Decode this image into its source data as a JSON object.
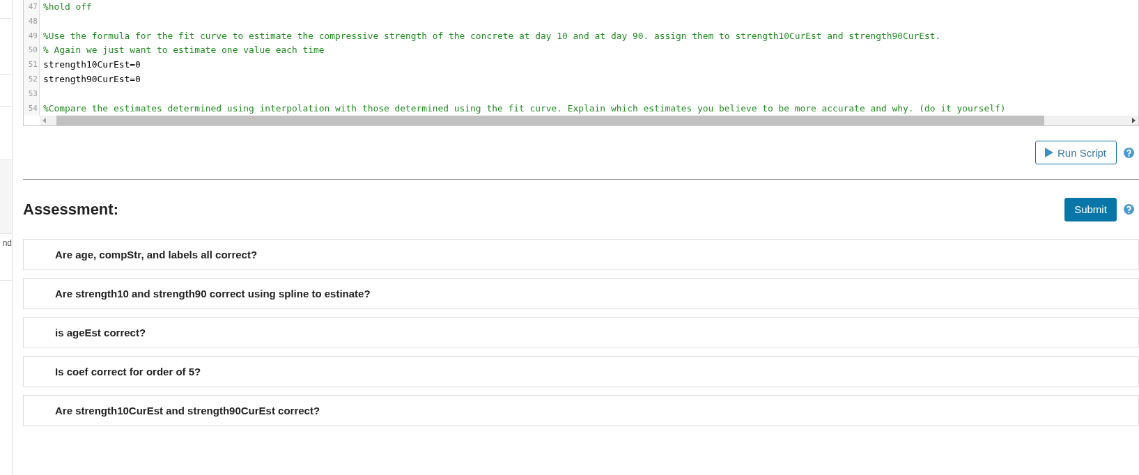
{
  "sidebar": {
    "text": "nd"
  },
  "editor": {
    "lines": [
      {
        "number": "47",
        "kind": "comment",
        "text": "%hold off"
      },
      {
        "number": "48",
        "kind": "blank"
      },
      {
        "number": "49",
        "kind": "comment",
        "text": "%Use the formula for the fit curve to estimate the compressive strength of the concrete at day 10 and at day 90. assign them to strength10CurEst and strength90CurEst."
      },
      {
        "number": "50",
        "kind": "comment",
        "text": "% Again we just want to estimate one value each time"
      },
      {
        "number": "51",
        "kind": "code",
        "text": "strength10CurEst=0"
      },
      {
        "number": "52",
        "kind": "code",
        "text": "strength90CurEst=0"
      },
      {
        "number": "53",
        "kind": "blank"
      },
      {
        "number": "54",
        "kind": "comment",
        "text": "%Compare the estimates determined using interpolation with those determined using the fit curve. Explain which estimates you believe to be more accurate and why. (do it yourself)"
      }
    ]
  },
  "run_button": {
    "label": "Run Script"
  },
  "assessment": {
    "title": "Assessment:",
    "submit": "Submit",
    "items": [
      "Are age, compStr, and labels all correct?",
      "Are strength10 and strength90 correct using spline to estinate?",
      "is ageEst correct?",
      "Is coef correct for order of 5?",
      "Are strength10CurEst and strength90CurEst correct?"
    ]
  }
}
